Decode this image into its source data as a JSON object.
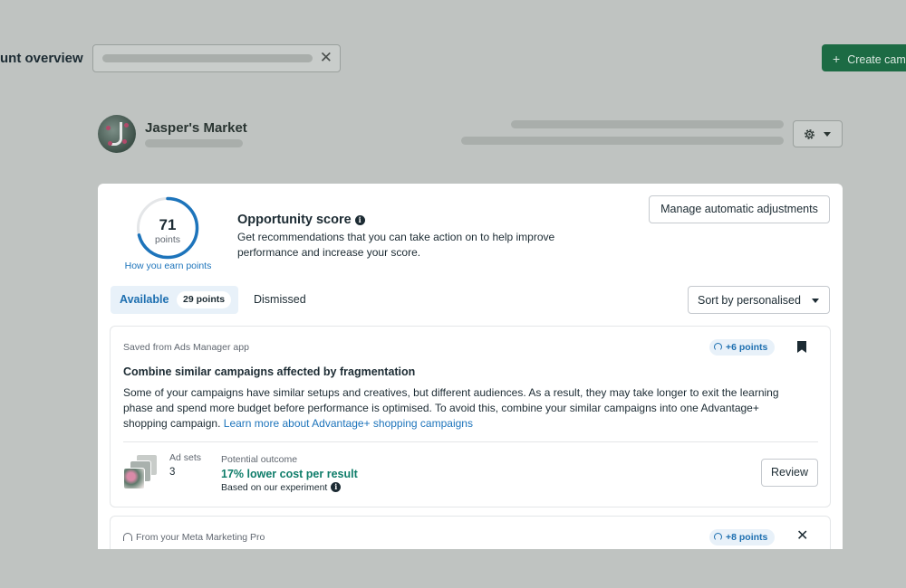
{
  "header": {
    "page_title": "unt overview",
    "create_button": "Create cam"
  },
  "account": {
    "name": "Jasper's Market"
  },
  "score": {
    "value": 71,
    "value_label": "71",
    "unit": "points",
    "max": 100,
    "earn_link": "How you earn points",
    "title": "Opportunity score",
    "description": "Get recommendations that you can take action on to help improve performance and increase your score.",
    "colors": {
      "ring": "#1d74bb",
      "track": "#e4e6e8"
    }
  },
  "actions": {
    "manage": "Manage automatic adjustments",
    "sort": "Sort by personalised"
  },
  "tabs": {
    "available": "Available",
    "available_badge": "29 points",
    "dismissed": "Dismissed"
  },
  "recommendations": [
    {
      "source": "Saved from Ads Manager app",
      "points": "+6 points",
      "title": "Combine similar campaigns affected by fragmentation",
      "body": "Some of your campaigns have similar setups and creatives, but different audiences. As a result, they may take longer to exit the learning phase and spend more budget before performance is optimised. To avoid this, combine your similar campaigns into one Advantage+ shopping campaign.",
      "link": "Learn more about Advantage+ shopping campaigns",
      "adsets_label": "Ad sets",
      "adsets_value": "3",
      "outcome_label": "Potential outcome",
      "outcome_value": "17% lower cost per result",
      "outcome_note": "Based on our experiment",
      "review": "Review"
    },
    {
      "source": "From your Meta Marketing Pro",
      "points": "+8 points"
    }
  ]
}
